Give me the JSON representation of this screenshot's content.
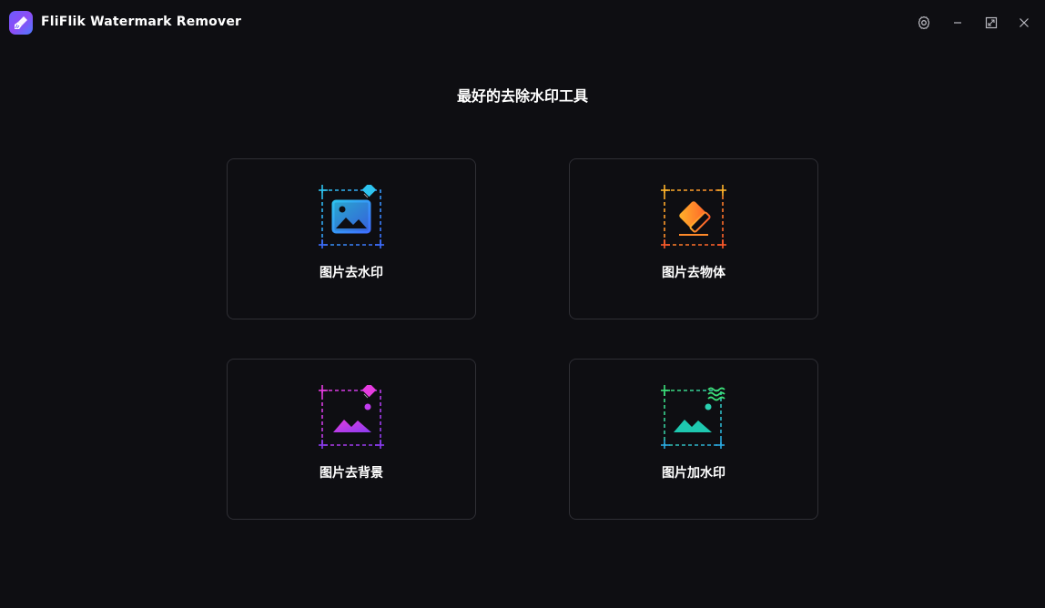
{
  "app": {
    "title": "FliFlik Watermark Remover",
    "logo_icon": "broom-icon"
  },
  "window_controls": {
    "settings_icon": "gear-icon",
    "minimize_icon": "minimize-icon",
    "maximize_icon": "maximize-icon",
    "close_icon": "close-icon"
  },
  "main": {
    "headline": "最好的去除水印工具",
    "cards": [
      {
        "label": "图片去水印",
        "icon": "image-watermark-remove-icon",
        "color": "#3d8bff"
      },
      {
        "label": "图片去物体",
        "icon": "eraser-object-remove-icon",
        "color": "#ff8a2a"
      },
      {
        "label": "图片去背景",
        "icon": "image-background-remove-icon",
        "color": "#c23cf0"
      },
      {
        "label": "图片加水印",
        "icon": "image-add-watermark-icon",
        "color": "#1ec8b0"
      }
    ]
  }
}
